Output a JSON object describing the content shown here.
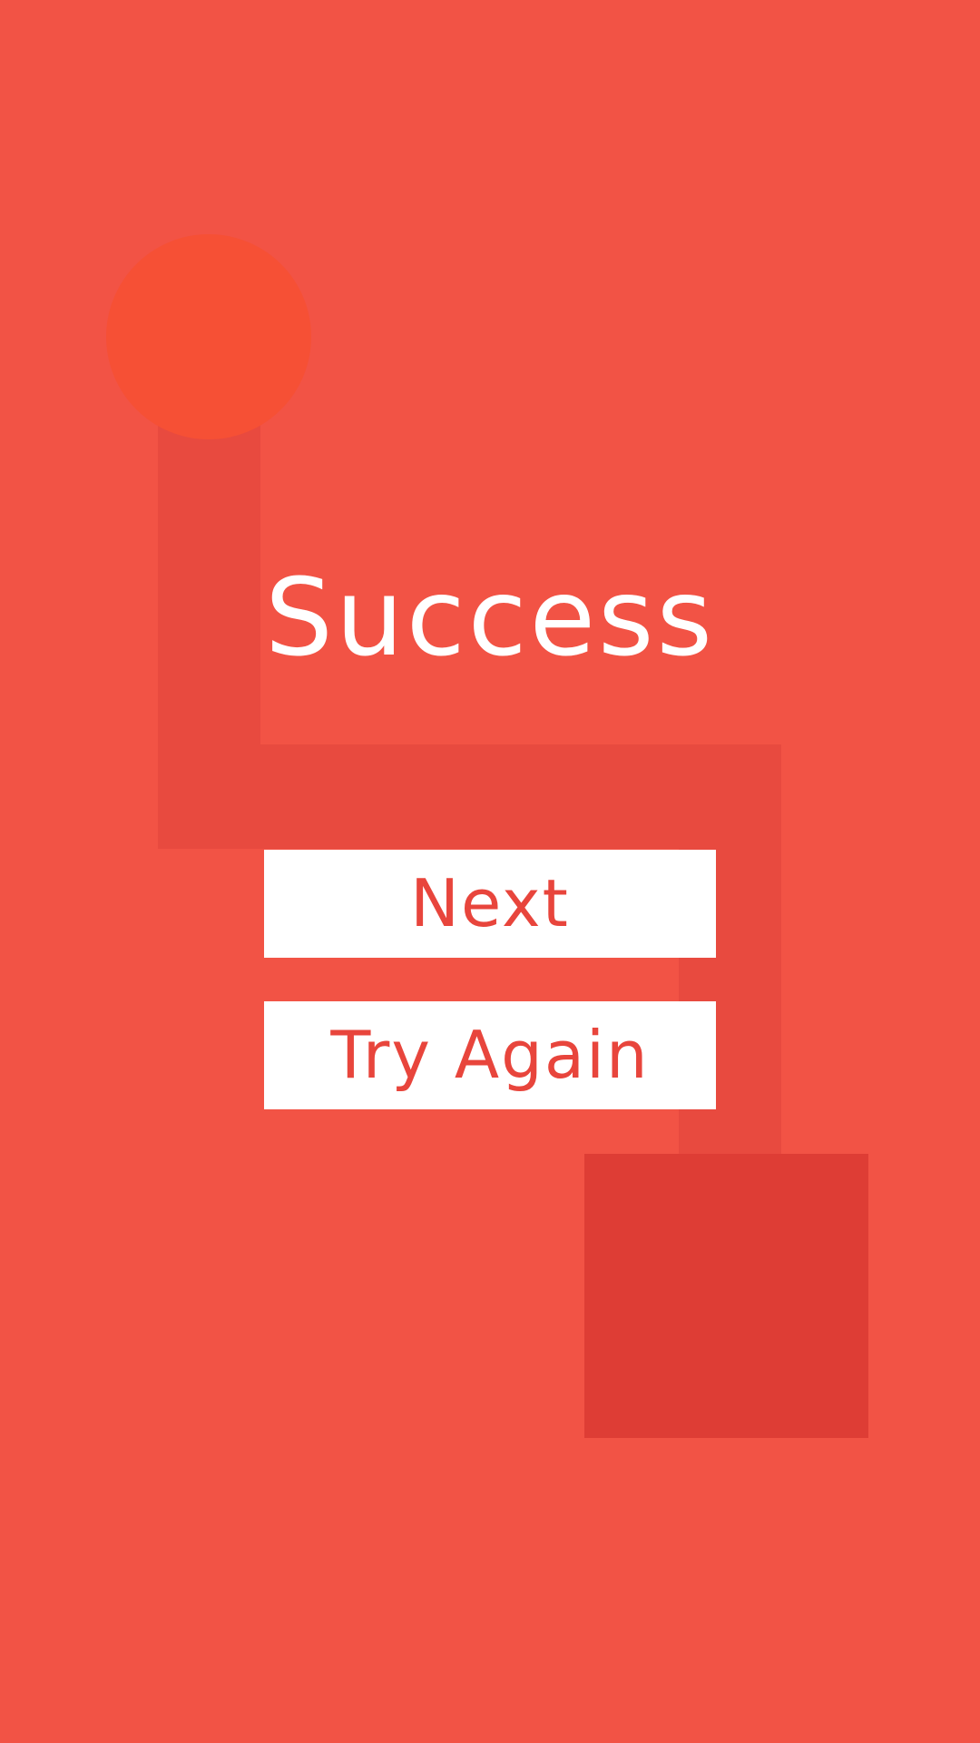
{
  "screen": {
    "title": "Success"
  },
  "buttons": {
    "next_label": "Next",
    "try_again_label": "Try Again"
  },
  "colors": {
    "background": "#F25345",
    "path": "#E84A3F",
    "start_circle": "#F65035",
    "goal_square": "#DE3D35",
    "button_background": "#FFFFFF",
    "button_text": "#E8453C",
    "title_text": "#FFFFFF"
  }
}
